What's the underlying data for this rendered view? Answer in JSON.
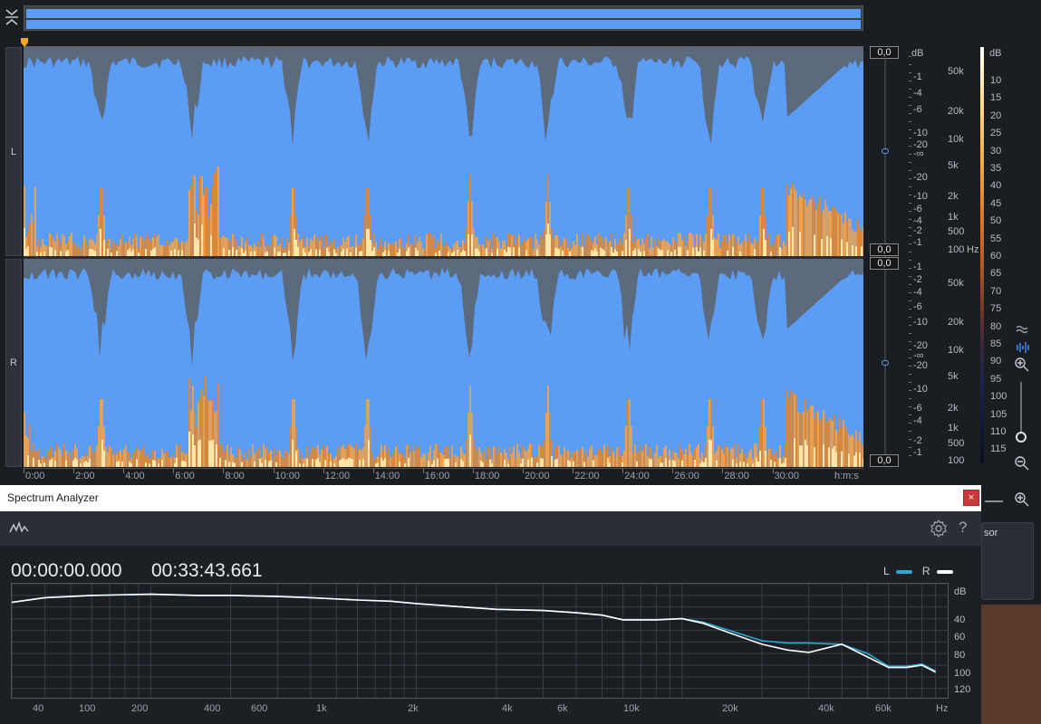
{
  "editor": {
    "channels": [
      {
        "label": "L"
      },
      {
        "label": "R"
      }
    ],
    "level_values": [
      "0,0",
      "0,0",
      "0,0",
      "0,0"
    ],
    "db_unit": "dB",
    "hz_unit": "Hz",
    "db_scale_l": [
      "-1",
      "-4",
      "-6",
      "-10",
      "-20",
      "-∞",
      "-20",
      "-10",
      "-6",
      "-4",
      "-2",
      "-1"
    ],
    "db_scale_r": [
      "-1",
      "-2",
      "-4",
      "-6",
      "-10",
      "-20",
      "-∞",
      "-20",
      "-10",
      "-6",
      "-4",
      "-2",
      "-1"
    ],
    "freq_scale_l": [
      "50k",
      "20k",
      "10k",
      "5k",
      "2k",
      "1k",
      "500",
      "100"
    ],
    "freq_scale_r": [
      "50k",
      "20k",
      "10k",
      "5k",
      "2k",
      "1k",
      "500",
      "100"
    ],
    "color_scale_unit": "dB",
    "color_scale": [
      "10",
      "15",
      "20",
      "25",
      "30",
      "35",
      "40",
      "45",
      "50",
      "55",
      "60",
      "65",
      "70",
      "75",
      "80",
      "85",
      "90",
      "95",
      "100",
      "105",
      "110",
      "115"
    ],
    "time_labels": [
      "0:00",
      "2:00",
      "4:00",
      "6:00",
      "8:00",
      "10:00",
      "12:00",
      "14:00",
      "16:00",
      "18:00",
      "20:00",
      "22:00",
      "24:00",
      "26:00",
      "28:00",
      "30:00"
    ],
    "time_unit": "h:m:s"
  },
  "spectrum_analyzer": {
    "title": "Spectrum Analyzer",
    "close_label": "×",
    "settings_icon": "gear-icon",
    "help_label": "?",
    "start_time": "00:00:00.000",
    "end_time": "00:33:43.661",
    "legend": [
      {
        "label": "L",
        "color": "#2aa9d6"
      },
      {
        "label": "R",
        "color": "#ffffff"
      }
    ],
    "side_panel_label": "sor"
  },
  "chart_data": {
    "type": "line",
    "xlabel": "Hz",
    "ylabel": "dB",
    "x_ticks": [
      "40",
      "100",
      "200",
      "400",
      "600",
      "1k",
      "2k",
      "4k",
      "6k",
      "10k",
      "20k",
      "40k",
      "60k",
      "Hz"
    ],
    "y_ticks": [
      "dB",
      "40",
      "60",
      "80",
      "100",
      "120"
    ],
    "x": [
      30,
      40,
      60,
      100,
      150,
      200,
      300,
      400,
      600,
      800,
      1000,
      1500,
      2000,
      3000,
      4000,
      5000,
      6000,
      8000,
      10000,
      12000,
      15000,
      20000,
      25000,
      30000,
      40000,
      50000,
      60000,
      70000,
      80000,
      90000
    ],
    "series": [
      {
        "name": "L",
        "values": [
          -46,
          -42,
          -40,
          -39,
          -40,
          -40,
          -41,
          -42,
          -44,
          -45,
          -47,
          -50,
          -52,
          -53,
          -55,
          -57,
          -61,
          -61,
          -60,
          -63,
          -70,
          -79,
          -81,
          -81,
          -82,
          -90,
          -101,
          -101,
          -99,
          -105
        ]
      },
      {
        "name": "R",
        "values": [
          -46,
          -42,
          -40,
          -39,
          -40,
          -40,
          -41,
          -42,
          -44,
          -45,
          -47,
          -50,
          -52,
          -53,
          -55,
          -57,
          -61,
          -61,
          -60,
          -64,
          -72,
          -82,
          -87,
          -89,
          -82,
          -93,
          -102,
          -102,
          -100,
          -106
        ]
      }
    ],
    "ylim": [
      -128,
      -30
    ],
    "xlim": [
      30,
      100000
    ],
    "x_scale": "log",
    "grid": true,
    "legend_position": "top-right"
  }
}
